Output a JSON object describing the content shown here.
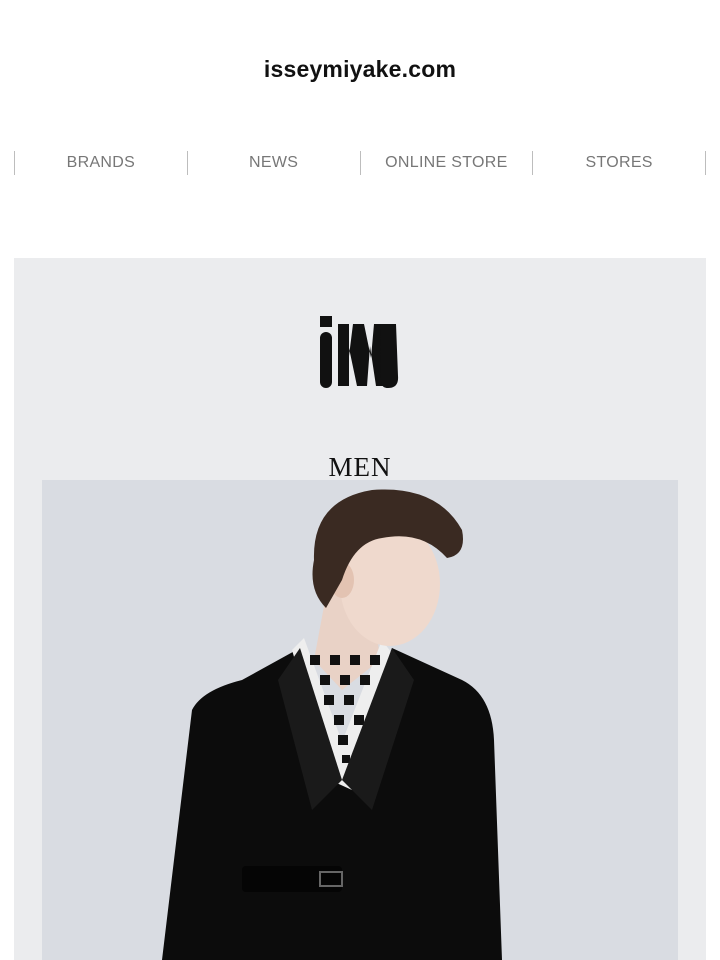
{
  "header": {
    "site_title": "isseymiyake.com"
  },
  "nav": {
    "items": [
      "BRANDS",
      "NEWS",
      "ONLINE STORE",
      "STORES"
    ]
  },
  "brand": {
    "logo_text": "MEN"
  },
  "colors": {
    "panel_bg": "#ebecee",
    "hero_bg": "#d9dce2",
    "nav_text": "#777777"
  }
}
